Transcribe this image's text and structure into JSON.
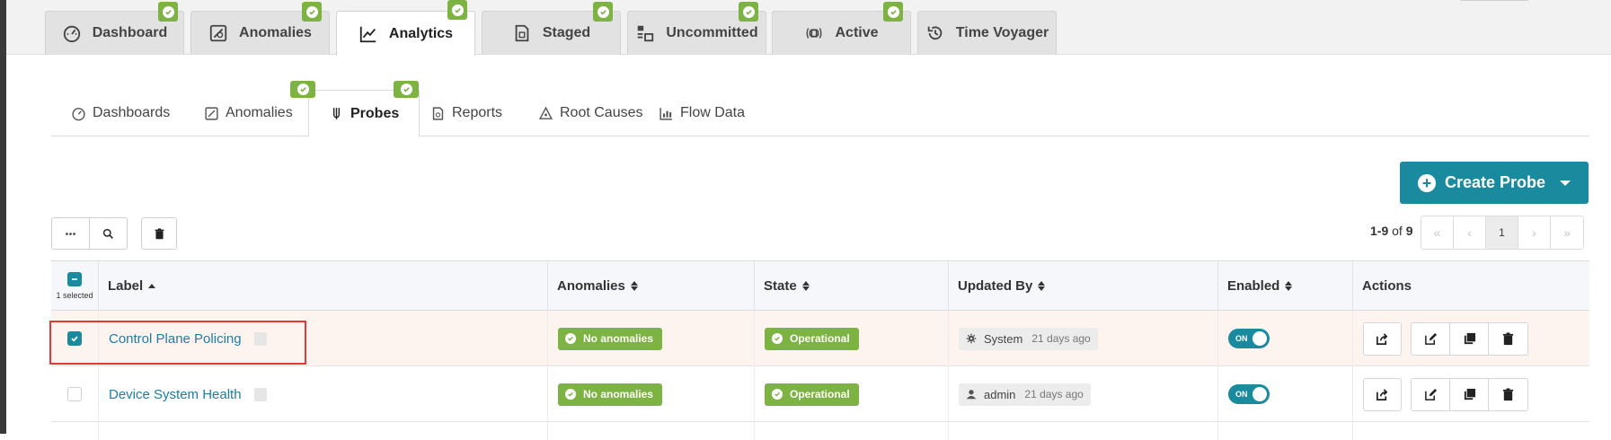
{
  "top_tabs": [
    {
      "label": "Dashboard",
      "icon": "gauge-icon"
    },
    {
      "label": "Anomalies",
      "icon": "shield-alert-icon"
    },
    {
      "label": "Analytics",
      "icon": "line-chart-icon"
    },
    {
      "label": "Staged",
      "icon": "document-icon"
    },
    {
      "label": "Uncommitted",
      "icon": "uncommitted-icon"
    },
    {
      "label": "Active",
      "icon": "broadcast-icon"
    },
    {
      "label": "Time Voyager",
      "icon": "history-icon"
    }
  ],
  "sub_tabs": [
    {
      "label": "Dashboards",
      "icon": "gauge-icon"
    },
    {
      "label": "Anomalies",
      "icon": "shield-alert-icon"
    },
    {
      "label": "Probes",
      "icon": "probe-icon"
    },
    {
      "label": "Reports",
      "icon": "report-icon"
    },
    {
      "label": "Root Causes",
      "icon": "root-cause-icon"
    },
    {
      "label": "Flow Data",
      "icon": "flow-chart-icon"
    }
  ],
  "create_button": {
    "label": "Create Probe"
  },
  "pagination": {
    "range": "1-9",
    "of_label": "of",
    "total": "9",
    "current_page": "1"
  },
  "table": {
    "selection_label": "1 selected",
    "columns": {
      "label": "Label",
      "anomalies": "Anomalies",
      "state": "State",
      "updated_by": "Updated By",
      "enabled": "Enabled",
      "actions": "Actions"
    },
    "rows": [
      {
        "label": "Control Plane Policing",
        "anomalies": "No anomalies",
        "state": "Operational",
        "updated_by": "System",
        "updated_ago": "21 days ago",
        "enabled": "ON",
        "selected": true
      },
      {
        "label": "Device System Health",
        "anomalies": "No anomalies",
        "state": "Operational",
        "updated_by": "admin",
        "updated_ago": "21 days ago",
        "enabled": "ON",
        "selected": false
      }
    ]
  },
  "colors": {
    "accent": "#1a8a9e",
    "success": "#7cb342",
    "link": "#1a7fa8",
    "highlight": "#e53935",
    "selected_row": "#fdf3ef"
  }
}
